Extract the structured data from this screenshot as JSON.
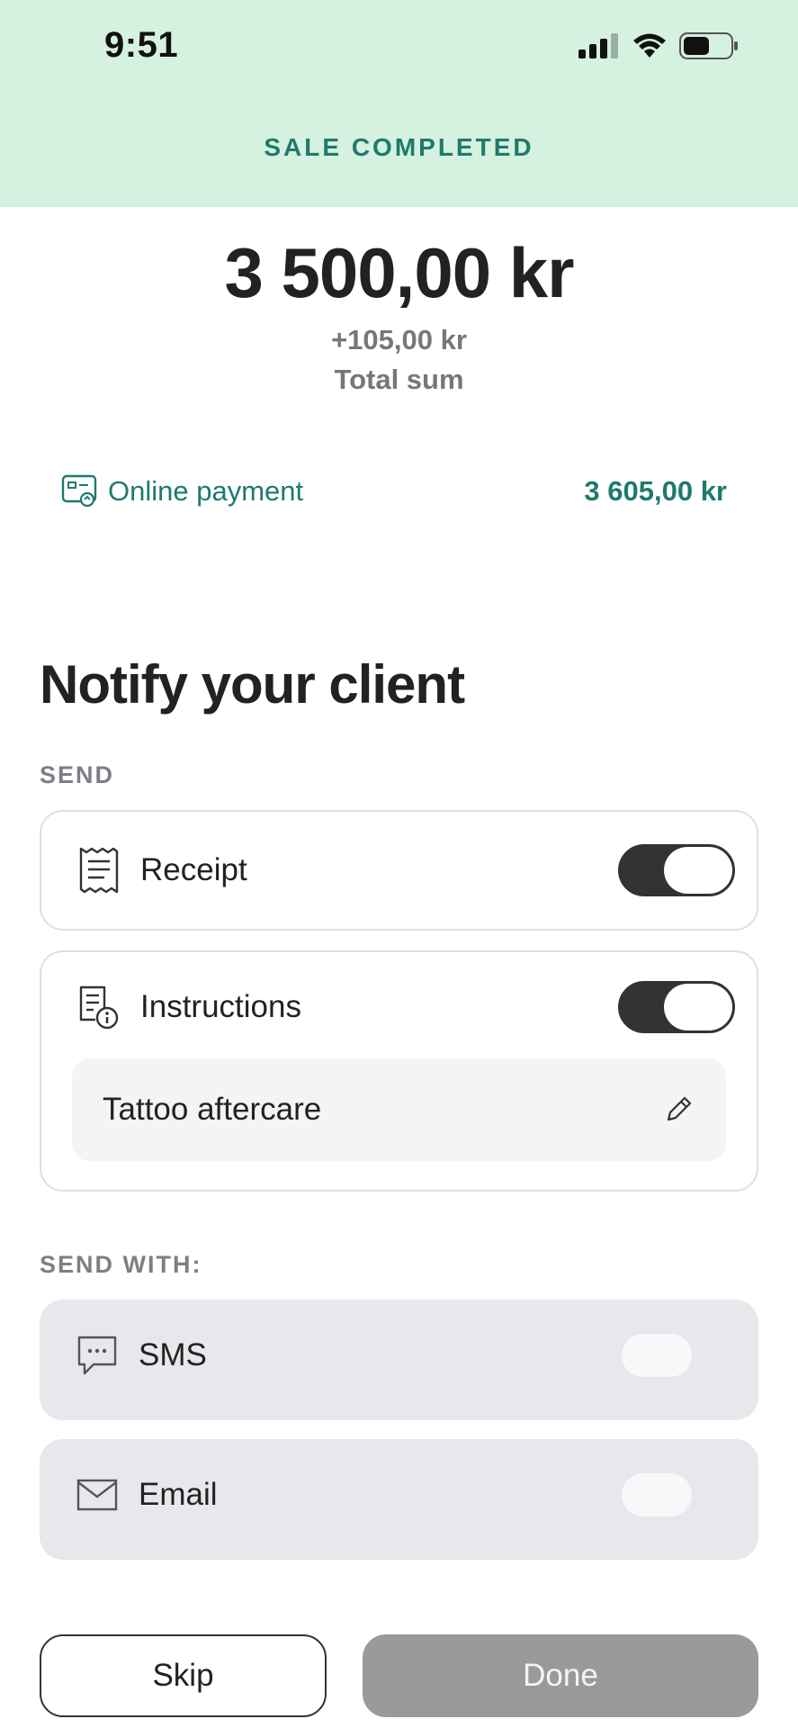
{
  "status_bar": {
    "time": "9:51"
  },
  "header": {
    "title": "SALE COMPLETED",
    "background": "#d5f1df",
    "accent": "#1e7a6d"
  },
  "summary": {
    "amount": "3 500,00 kr",
    "fee": "+105,00 kr",
    "total_label": "Total sum"
  },
  "payment": {
    "icon": "online-payment-icon",
    "method": "Online payment",
    "amount": "3 605,00 kr"
  },
  "notify": {
    "title": "Notify your client",
    "send_label": "SEND",
    "receipt": {
      "label": "Receipt",
      "icon": "receipt-icon",
      "enabled": true
    },
    "instructions": {
      "label": "Instructions",
      "icon": "instructions-icon",
      "enabled": true,
      "selected": "Tattoo aftercare",
      "edit_icon": "pencil-icon"
    },
    "send_with_label": "SEND WITH:",
    "sms": {
      "label": "SMS",
      "icon": "message-icon",
      "enabled": false
    },
    "email": {
      "label": "Email",
      "icon": "envelope-icon",
      "enabled": false
    }
  },
  "actions": {
    "skip": "Skip",
    "done": "Done"
  }
}
